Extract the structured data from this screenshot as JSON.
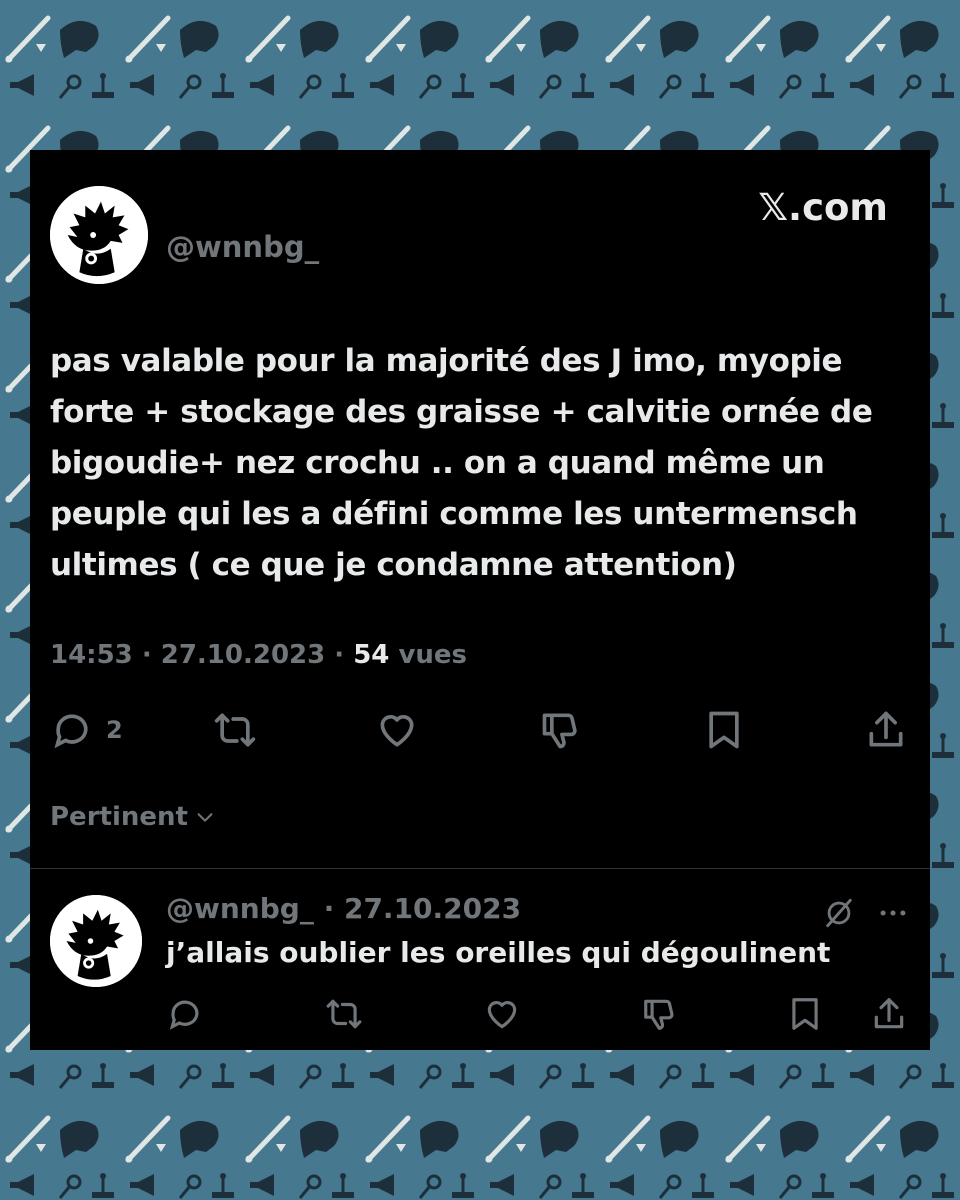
{
  "brand": "𝕏.com",
  "tweet": {
    "handle": "@wnnbg_",
    "lines": [
      "pas valable pour la majorité des J imo, myopie",
      "forte + stockage des graisse + calvitie ornée de",
      "bigoudie+ nez crochu .. on a quand même un",
      "peuple qui les a défini comme les untermensch",
      "ultimes ( ce que je condamne attention)"
    ],
    "time": "14:53",
    "date": "27.10.2023",
    "views_count": "54",
    "views_label": "vues",
    "separator": " · ",
    "replies_count": "2"
  },
  "sort_label": "Pertinent",
  "reply": {
    "handle": "@wnnbg_",
    "date": "27.10.2023",
    "separator": " · ",
    "text": "j’allais oublier les oreilles qui dégoulinent"
  },
  "icons": {
    "reply": "comment-icon",
    "retweet": "repost-icon",
    "like": "heart-icon",
    "dislike": "thumbs-down-icon",
    "bookmark": "bookmark-icon",
    "share": "share-icon",
    "chevron": "chevron-down-icon",
    "grok": "grok-icon",
    "more": "more-icon"
  },
  "colors": {
    "background": "#46788f",
    "card": "#000000",
    "text": "#e7e9ea",
    "muted": "#71767b"
  }
}
